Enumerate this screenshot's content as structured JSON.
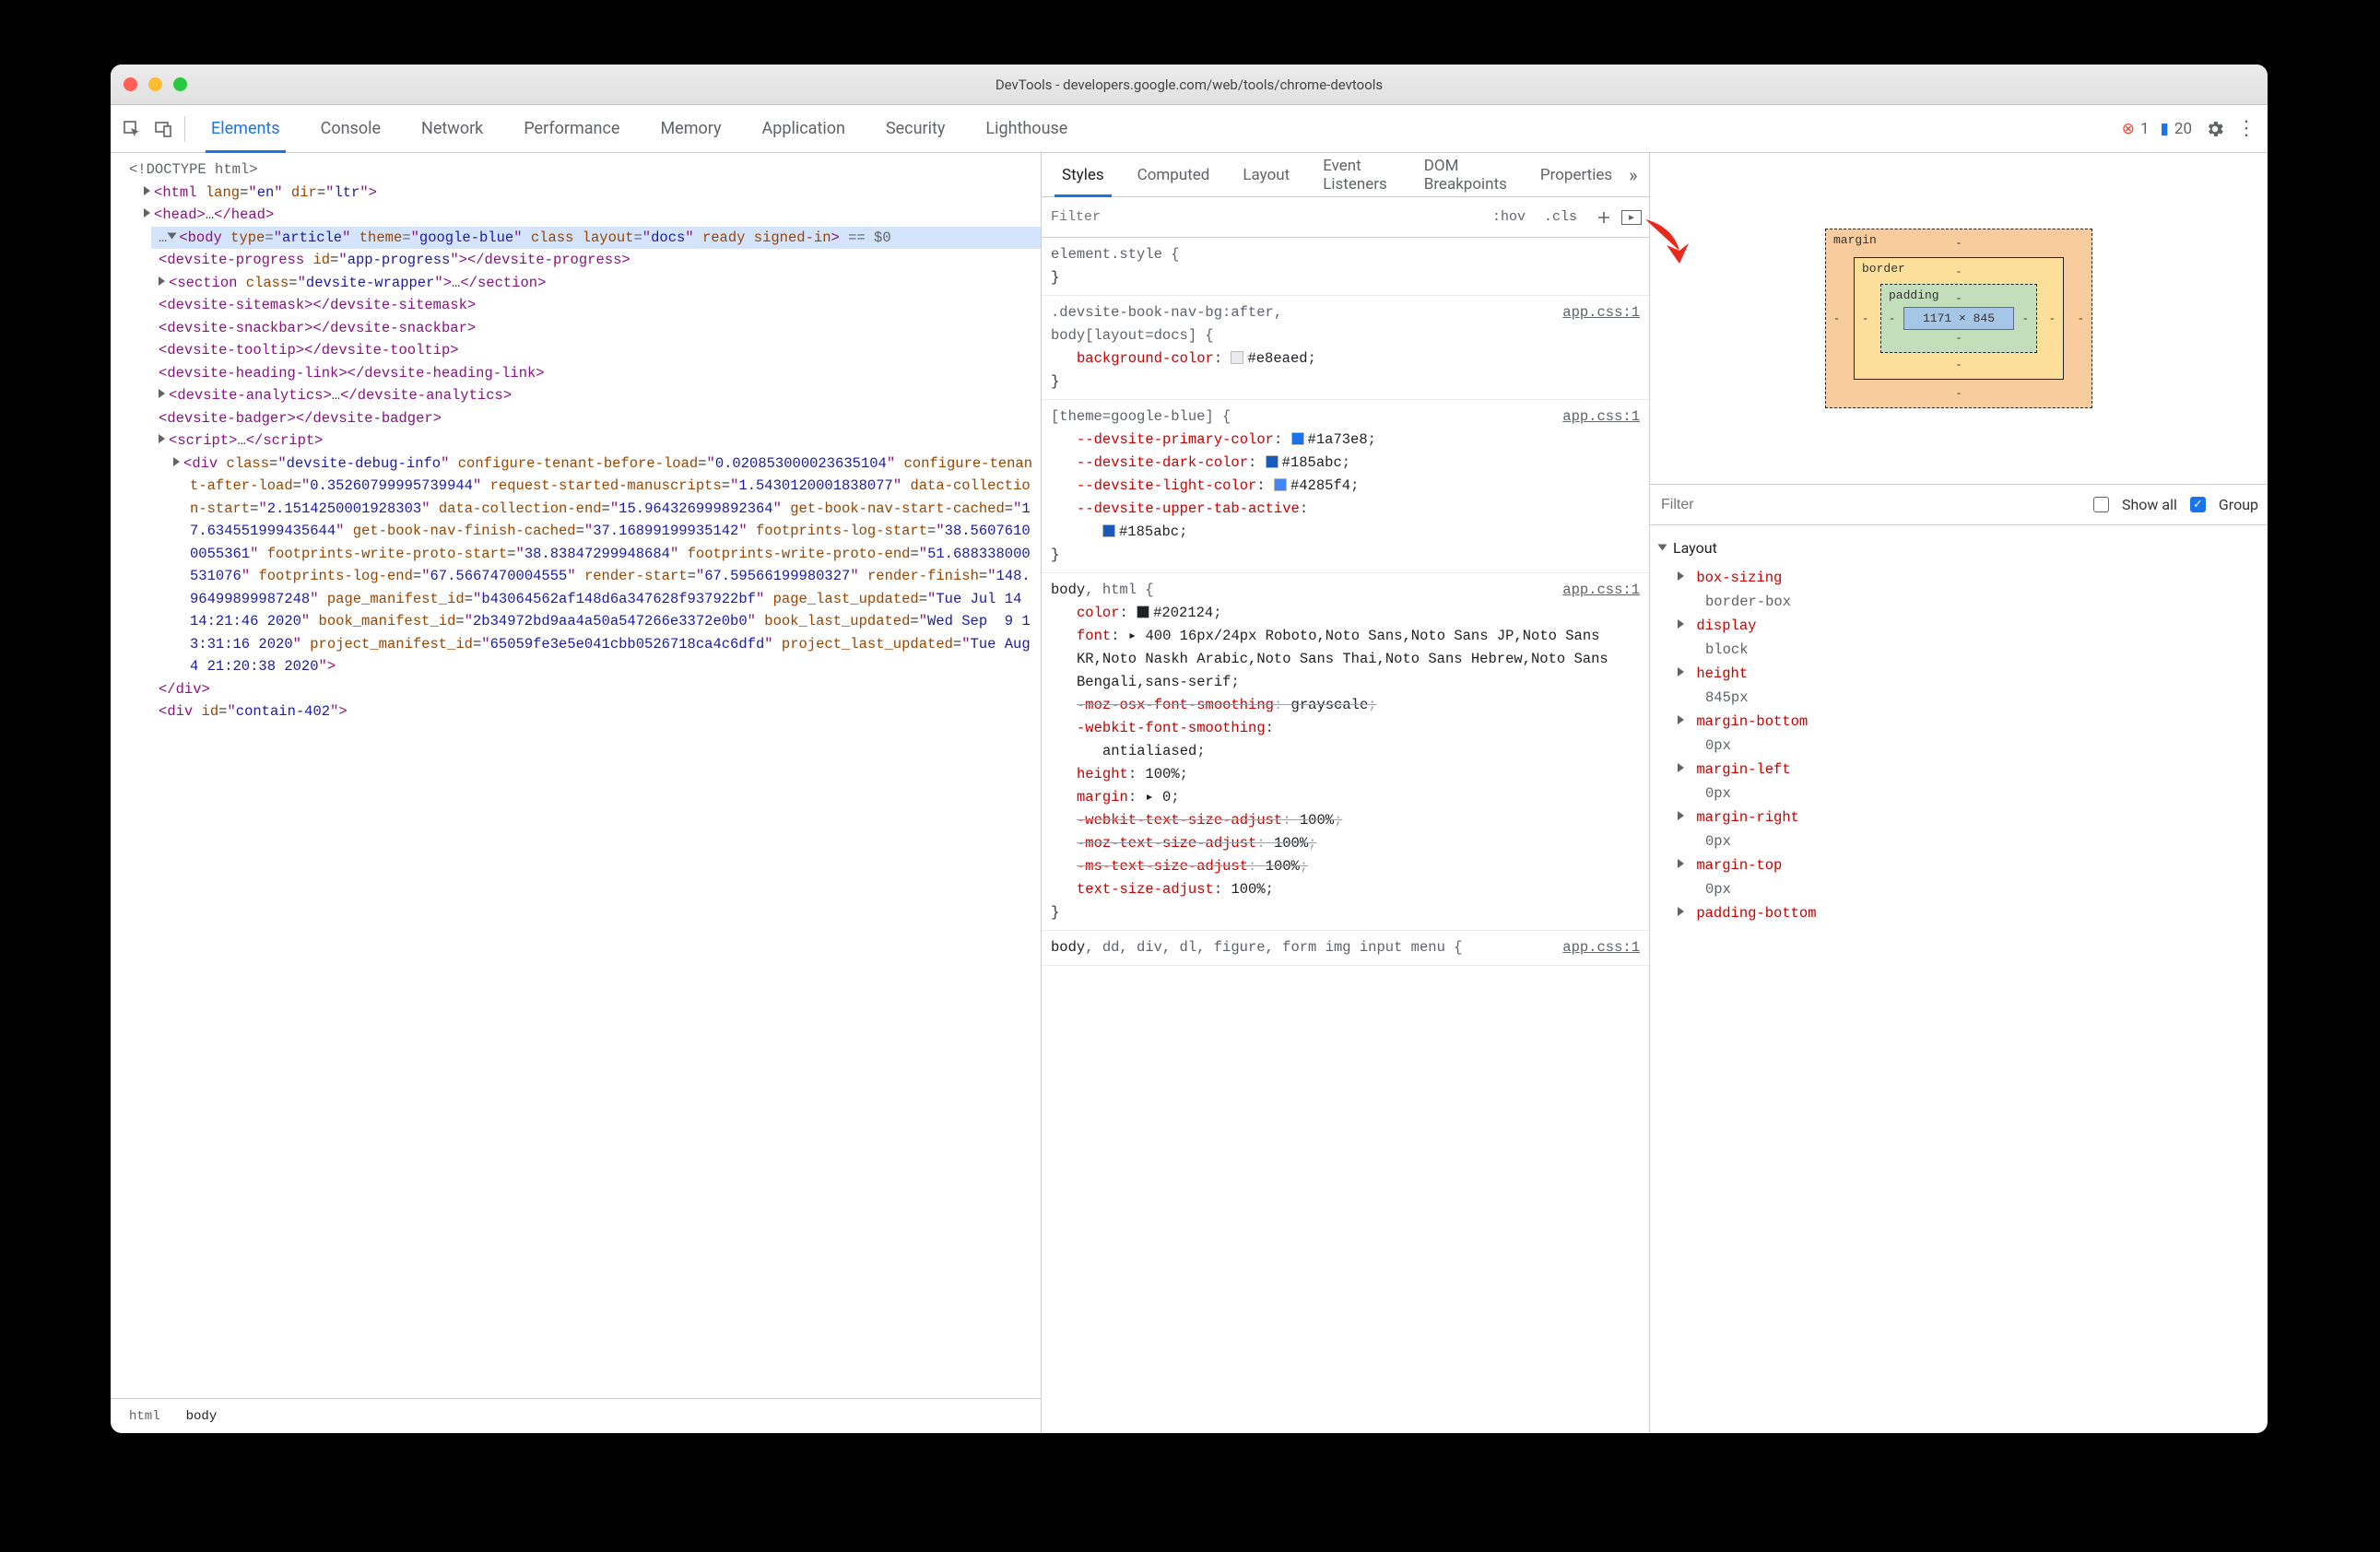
{
  "window": {
    "title": "DevTools - developers.google.com/web/tools/chrome-devtools"
  },
  "mainTabs": {
    "items": [
      "Elements",
      "Console",
      "Network",
      "Performance",
      "Memory",
      "Application",
      "Security",
      "Lighthouse"
    ],
    "active": 0
  },
  "counts": {
    "errors": "1",
    "messages": "20"
  },
  "subTabs": {
    "items": [
      "Styles",
      "Computed",
      "Layout",
      "Event Listeners",
      "DOM Breakpoints",
      "Properties"
    ],
    "active": 0,
    "layoutVisible": "Event Listeners",
    "eventsCut": "E"
  },
  "stylesFilter": {
    "placeholder": "Filter",
    "hov": ":hov",
    "cls": ".cls"
  },
  "breadcrumb": {
    "items": [
      "html",
      "body"
    ],
    "active": 1
  },
  "tree": {
    "lines": [
      {
        "kind": "comment",
        "text": "<!DOCTYPE html>"
      },
      {
        "kind": "open",
        "tag": "html",
        "attrs": [
          [
            "lang",
            "en"
          ],
          [
            "dir",
            "ltr"
          ]
        ]
      },
      {
        "kind": "collapsed",
        "tag": "head"
      },
      {
        "kind": "open-sel",
        "tag": "body",
        "attrs": [
          [
            "type",
            "article"
          ],
          [
            "theme",
            "google-blue"
          ],
          [
            "class",
            ""
          ],
          [
            "layout",
            "docs"
          ],
          [
            "ready",
            ""
          ],
          [
            "signed-in",
            ""
          ]
        ],
        "suffix": " == $0",
        "selected": true,
        "open": true
      },
      {
        "kind": "pair",
        "tag": "devsite-progress",
        "attrs": [
          [
            "id",
            "app-progress"
          ]
        ]
      },
      {
        "kind": "collapsed",
        "tag": "section",
        "attrs": [
          [
            "class",
            "devsite-wrapper"
          ]
        ]
      },
      {
        "kind": "pair",
        "tag": "devsite-sitemask"
      },
      {
        "kind": "pair",
        "tag": "devsite-snackbar"
      },
      {
        "kind": "pair",
        "tag": "devsite-tooltip"
      },
      {
        "kind": "pair",
        "tag": "devsite-heading-link"
      },
      {
        "kind": "collapsed",
        "tag": "devsite-analytics"
      },
      {
        "kind": "pair",
        "tag": "devsite-badger"
      },
      {
        "kind": "collapsed",
        "tag": "script"
      },
      {
        "kind": "open",
        "tag": "div",
        "attrs": [
          [
            "class",
            "devsite-debug-info"
          ],
          [
            "configure-tenant-before-load",
            "0.020853000023635104"
          ],
          [
            "configure-tenant-after-load",
            "0.35260799995739944"
          ],
          [
            "request-started-manuscripts",
            "1.5430120001838077"
          ],
          [
            "data-collection-start",
            "2.1514250001928303"
          ],
          [
            "data-collection-end",
            "15.964326999892364"
          ],
          [
            "get-book-nav-start-cached",
            "17.634551999435644"
          ],
          [
            "get-book-nav-finish-cached",
            "37.16899199935142"
          ],
          [
            "footprints-log-start",
            "38.56076100055361"
          ],
          [
            "footprints-write-proto-start",
            "38.83847299948684"
          ],
          [
            "footprints-write-proto-end",
            "51.688338000531076"
          ],
          [
            "footprints-log-end",
            "67.5667470004555"
          ],
          [
            "render-start",
            "67.59566199980327"
          ],
          [
            "render-finish",
            "148.96499899987248"
          ],
          [
            "page_manifest_id",
            "b43064562af148d6a347628f937922bf"
          ],
          [
            "page_last_updated",
            "Tue Jul 14 14:21:46 2020"
          ],
          [
            "book_manifest_id",
            "2b34972bd9aa4a50a547266e3372e0b0"
          ],
          [
            "book_last_updated",
            "Wed Sep  9 13:31:16 2020"
          ],
          [
            "project_manifest_id",
            "65059fe3e5e041cbb0526718ca4c6dfd"
          ],
          [
            "project_last_updated",
            "Tue Aug  4 21:20:38 2020"
          ]
        ]
      },
      {
        "kind": "close",
        "tag": "div"
      },
      {
        "kind": "open-cut",
        "tag": "div",
        "attrs": [
          [
            "id",
            "contain-402"
          ]
        ]
      }
    ]
  },
  "styles": {
    "elementStyle": "element.style {",
    "rules": [
      {
        "selector": ".devsite-book-nav-bg:after,\nbody[layout=docs] {",
        "src": "app.css:1",
        "props": [
          {
            "name": "background-color",
            "value": "#e8eaed",
            "swatch": "#e8eaed"
          }
        ]
      },
      {
        "selector": "[theme=google-blue] {",
        "src": "app.css:1",
        "props": [
          {
            "name": "--devsite-primary-color",
            "value": "#1a73e8",
            "swatch": "#1a73e8"
          },
          {
            "name": "--devsite-dark-color",
            "value": "#185abc",
            "swatch": "#185abc"
          },
          {
            "name": "--devsite-light-color",
            "value": "#4285f4",
            "swatch": "#4285f4"
          },
          {
            "name": "--devsite-upper-tab-active",
            "value": "#185abc",
            "swatch": "#185abc",
            "wrap": true
          }
        ]
      },
      {
        "selector": "body, html {",
        "selectorStrong": "body",
        "selectorRest": ", html {",
        "src": "app.css:1",
        "props": [
          {
            "name": "color",
            "value": "#202124",
            "swatch": "#202124"
          },
          {
            "name": "font",
            "value": "▸ 400 16px/24px Roboto,Noto Sans,Noto Sans JP,Noto Sans KR,Noto Naskh Arabic,Noto Sans Thai,Noto Sans Hebrew,Noto Sans Bengali,sans-serif"
          },
          {
            "name": "-moz-osx-font-smoothing",
            "value": "grayscale",
            "strike": true
          },
          {
            "name": "-webkit-font-smoothing",
            "value": "antialiased",
            "wrap": true
          },
          {
            "name": "height",
            "value": "100%"
          },
          {
            "name": "margin",
            "value": "▸ 0"
          },
          {
            "name": "-webkit-text-size-adjust",
            "value": "100%",
            "strike": true
          },
          {
            "name": "-moz-text-size-adjust",
            "value": "100%",
            "strike": true
          },
          {
            "name": "-ms-text-size-adjust",
            "value": "100%",
            "strike": true
          },
          {
            "name": "text-size-adjust",
            "value": "100%"
          }
        ]
      },
      {
        "selector": "body, dd, div, dl, figure, form, img, input, menu {",
        "selectorStrong": "body",
        "selectorRest": ", dd, div, dl, figure, form  img  input  menu  {",
        "src": "app.css:1",
        "cut": true
      }
    ]
  },
  "boxModel": {
    "margin": {
      "label": "margin",
      "t": "-",
      "r": "-",
      "b": "-",
      "l": "-"
    },
    "border": {
      "label": "border",
      "t": "-",
      "r": "-",
      "b": "-",
      "l": "-"
    },
    "padding": {
      "label": "padding",
      "t": "-",
      "r": "-",
      "b": "-",
      "l": "-"
    },
    "content": "1171 × 845"
  },
  "computedFilter": {
    "placeholder": "Filter",
    "showAll": "Show all",
    "group": "Group",
    "groupChecked": true
  },
  "computed": {
    "groupLabel": "Layout",
    "props": [
      {
        "name": "box-sizing",
        "value": "border-box"
      },
      {
        "name": "display",
        "value": "block"
      },
      {
        "name": "height",
        "value": "845px"
      },
      {
        "name": "margin-bottom",
        "value": "0px"
      },
      {
        "name": "margin-left",
        "value": "0px"
      },
      {
        "name": "margin-right",
        "value": "0px"
      },
      {
        "name": "margin-top",
        "value": "0px"
      },
      {
        "name": "padding-bottom",
        "value": ""
      }
    ]
  }
}
